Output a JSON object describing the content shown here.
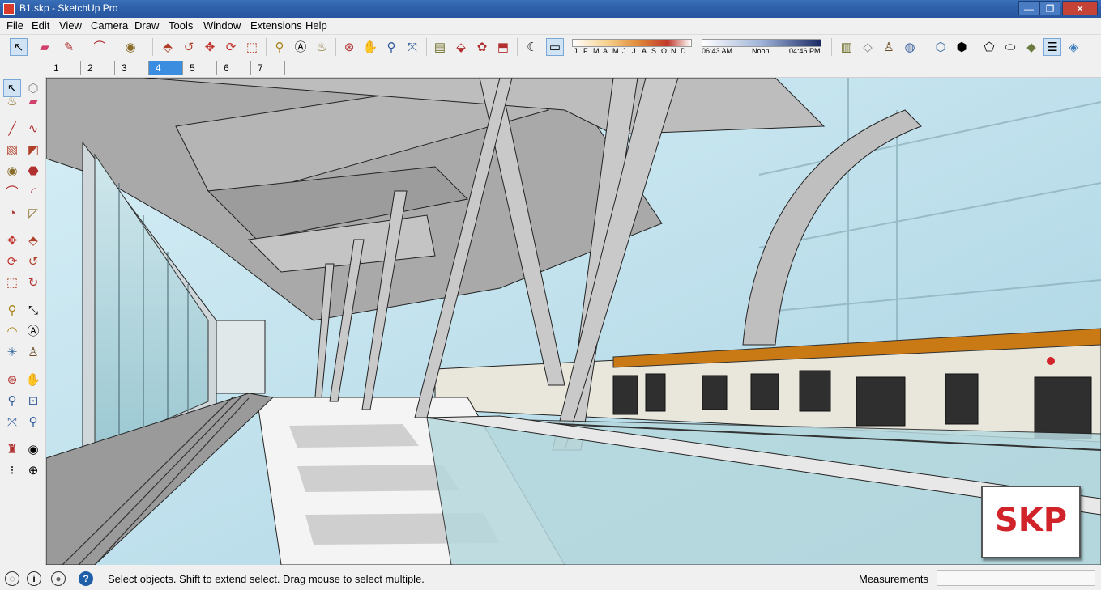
{
  "window": {
    "title": "B1.skp - SketchUp Pro",
    "minimize_glyph": "—",
    "maximize_glyph": "❐",
    "close_glyph": "✕"
  },
  "menu": [
    "File",
    "Edit",
    "View",
    "Camera",
    "Draw",
    "Tools",
    "Window",
    "Extensions",
    "Help"
  ],
  "toolbar": {
    "icons": [
      "select-icon",
      "eraser-icon",
      "pencil-icon",
      "arc-icon",
      "circle-icon",
      "push-pull-icon",
      "follow-me-icon",
      "move-icon",
      "rotate-icon",
      "scale-icon",
      "tape-measure-icon",
      "text-icon",
      "paint-bucket-icon",
      "orbit-icon",
      "pan-icon",
      "zoom-icon",
      "zoom-extents-icon",
      "warehouse-icon",
      "share-model-icon",
      "extension-warehouse-icon",
      "send-to-layout-icon",
      "shadows-icon",
      "fog-icon"
    ],
    "shadow_months": [
      "J",
      "F",
      "M",
      "A",
      "M",
      "J",
      "J",
      "A",
      "S",
      "O",
      "N",
      "D"
    ],
    "shadow_time_start": "06:43 AM",
    "shadow_time_mid": "Noon",
    "shadow_time_end": "04:46 PM",
    "view_icons": [
      "iso-view-icon",
      "top-view-icon",
      "front-view-icon",
      "right-view-icon",
      "back-view-icon",
      "left-view-icon",
      "x-ray-icon",
      "wireframe-icon",
      "hidden-line-icon",
      "shaded-icon",
      "textured-icon",
      "monochrome-icon"
    ]
  },
  "scenes": {
    "tabs": [
      "1",
      "2",
      "3",
      "4",
      "5",
      "6",
      "7"
    ],
    "active": "4"
  },
  "left_tools": [
    "select-icon",
    "component-icon",
    "paint-bucket-icon",
    "eraser-icon",
    "line-icon",
    "freehand-icon",
    "rectangle-icon",
    "rotated-rectangle-icon",
    "circle-icon",
    "polygon-icon",
    "arc-icon",
    "two-point-arc-icon",
    "pie-icon",
    "three-point-arc-icon",
    "move-icon",
    "push-pull-icon",
    "rotate-icon",
    "follow-me-icon",
    "scale-icon",
    "offset-icon",
    "tape-measure-icon",
    "dimension-icon",
    "protractor-icon",
    "text-icon",
    "axes-icon",
    "3d-text-icon",
    "orbit-icon",
    "pan-icon",
    "zoom-icon",
    "zoom-window-icon",
    "zoom-extents-icon",
    "previous-view-icon",
    "position-camera-icon",
    "look-around-icon",
    "walk-icon",
    "section-plane-icon"
  ],
  "status": {
    "text": "Select objects. Shift to extend select. Drag mouse to select multiple.",
    "measurements_label": "Measurements",
    "measurements_value": "",
    "help_glyph": "?",
    "info_glyph": "i"
  },
  "badge": {
    "text": "SKP"
  },
  "colors": {
    "title_bar": "#2d5fa8",
    "active_scene": "#3b8de0",
    "badge_red": "#d1242a",
    "sky": "#cfe6ee"
  }
}
